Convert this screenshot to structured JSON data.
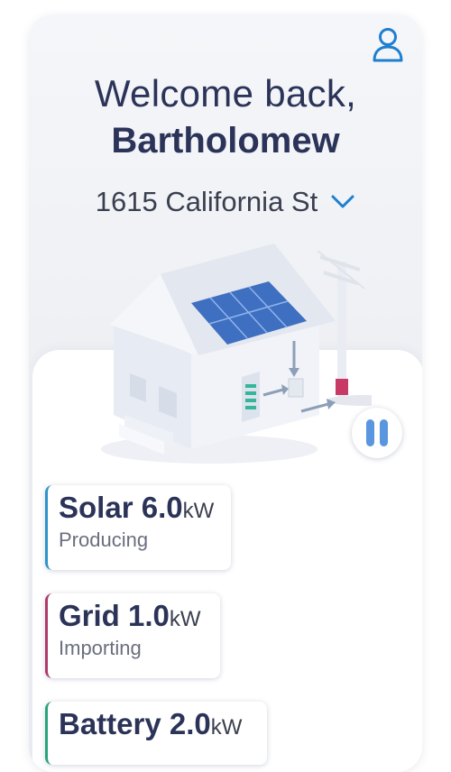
{
  "header": {
    "greeting": "Welcome back,",
    "user_name": "Bartholomew"
  },
  "address": {
    "label": "1615 California St"
  },
  "energy_cards": [
    {
      "name": "Solar",
      "value": "6.0",
      "unit": "kW",
      "status": "Producing",
      "accent": "#2f93c8"
    },
    {
      "name": "Grid",
      "value": "1.0",
      "unit": "kW",
      "status": "Importing",
      "accent": "#b03a6a"
    },
    {
      "name": "Battery",
      "value": "2.0",
      "unit": "kW",
      "status": "",
      "accent": "#2aa37a"
    }
  ],
  "colors": {
    "primary_text": "#2b3458",
    "accent_blue": "#1e7fd0",
    "pause_button": "#5a96e0"
  }
}
